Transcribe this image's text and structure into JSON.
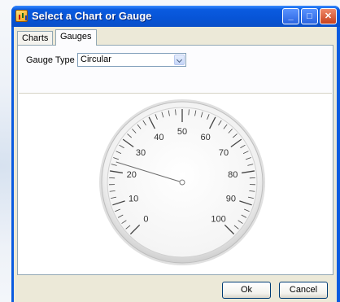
{
  "window": {
    "title": "Select a Chart or Gauge"
  },
  "title_buttons": {
    "minimize": "_",
    "maximize": "□",
    "close": "✕"
  },
  "tabs": [
    {
      "label": "Charts"
    },
    {
      "label": "Gauges"
    }
  ],
  "gauge_type": {
    "label": "Gauge Type",
    "value": "Circular"
  },
  "gauge": {
    "min": 0,
    "max": 100,
    "major_step": 10,
    "minor_per_major": 5,
    "needle_value": 23,
    "labels": [
      "0",
      "10",
      "20",
      "30",
      "40",
      "50",
      "60",
      "70",
      "80",
      "90",
      "100"
    ]
  },
  "buttons": {
    "ok": "Ok",
    "cancel": "Cancel"
  }
}
